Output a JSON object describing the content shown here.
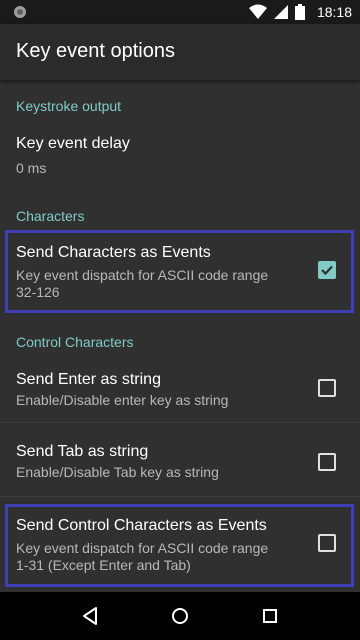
{
  "status_bar": {
    "time": "18:18",
    "icons": [
      "notification-icon",
      "wifi-icon",
      "cell-signal-icon",
      "battery-icon"
    ]
  },
  "app_bar": {
    "title": "Key event options"
  },
  "sections": {
    "keystroke": {
      "header": "Keystroke output",
      "key_event_delay": {
        "title": "Key event delay",
        "summary": "0 ms"
      }
    },
    "characters": {
      "header": "Characters",
      "send_chars_as_events": {
        "title": "Send Characters as Events",
        "summary_line1": "Key event dispatch for ASCII code range",
        "summary_line2": "32-126",
        "checked": true
      }
    },
    "control": {
      "header": "Control Characters",
      "send_enter": {
        "title": "Send Enter as string",
        "summary": "Enable/Disable enter key as string",
        "checked": false
      },
      "send_tab": {
        "title": "Send Tab as string",
        "summary": "Enable/Disable Tab key as string",
        "checked": false
      },
      "send_control_as_events": {
        "title": "Send Control Characters as Events",
        "summary_line1": "Key event dispatch for ASCII code range",
        "summary_line2": "1-31 (Except Enter and Tab)",
        "checked": false
      }
    }
  },
  "colors": {
    "accent": "#80cbc4",
    "highlight_border": "#3f3fb8",
    "background": "#303030"
  },
  "nav_bar": {
    "buttons": [
      "back-icon",
      "home-icon",
      "recents-icon"
    ]
  }
}
